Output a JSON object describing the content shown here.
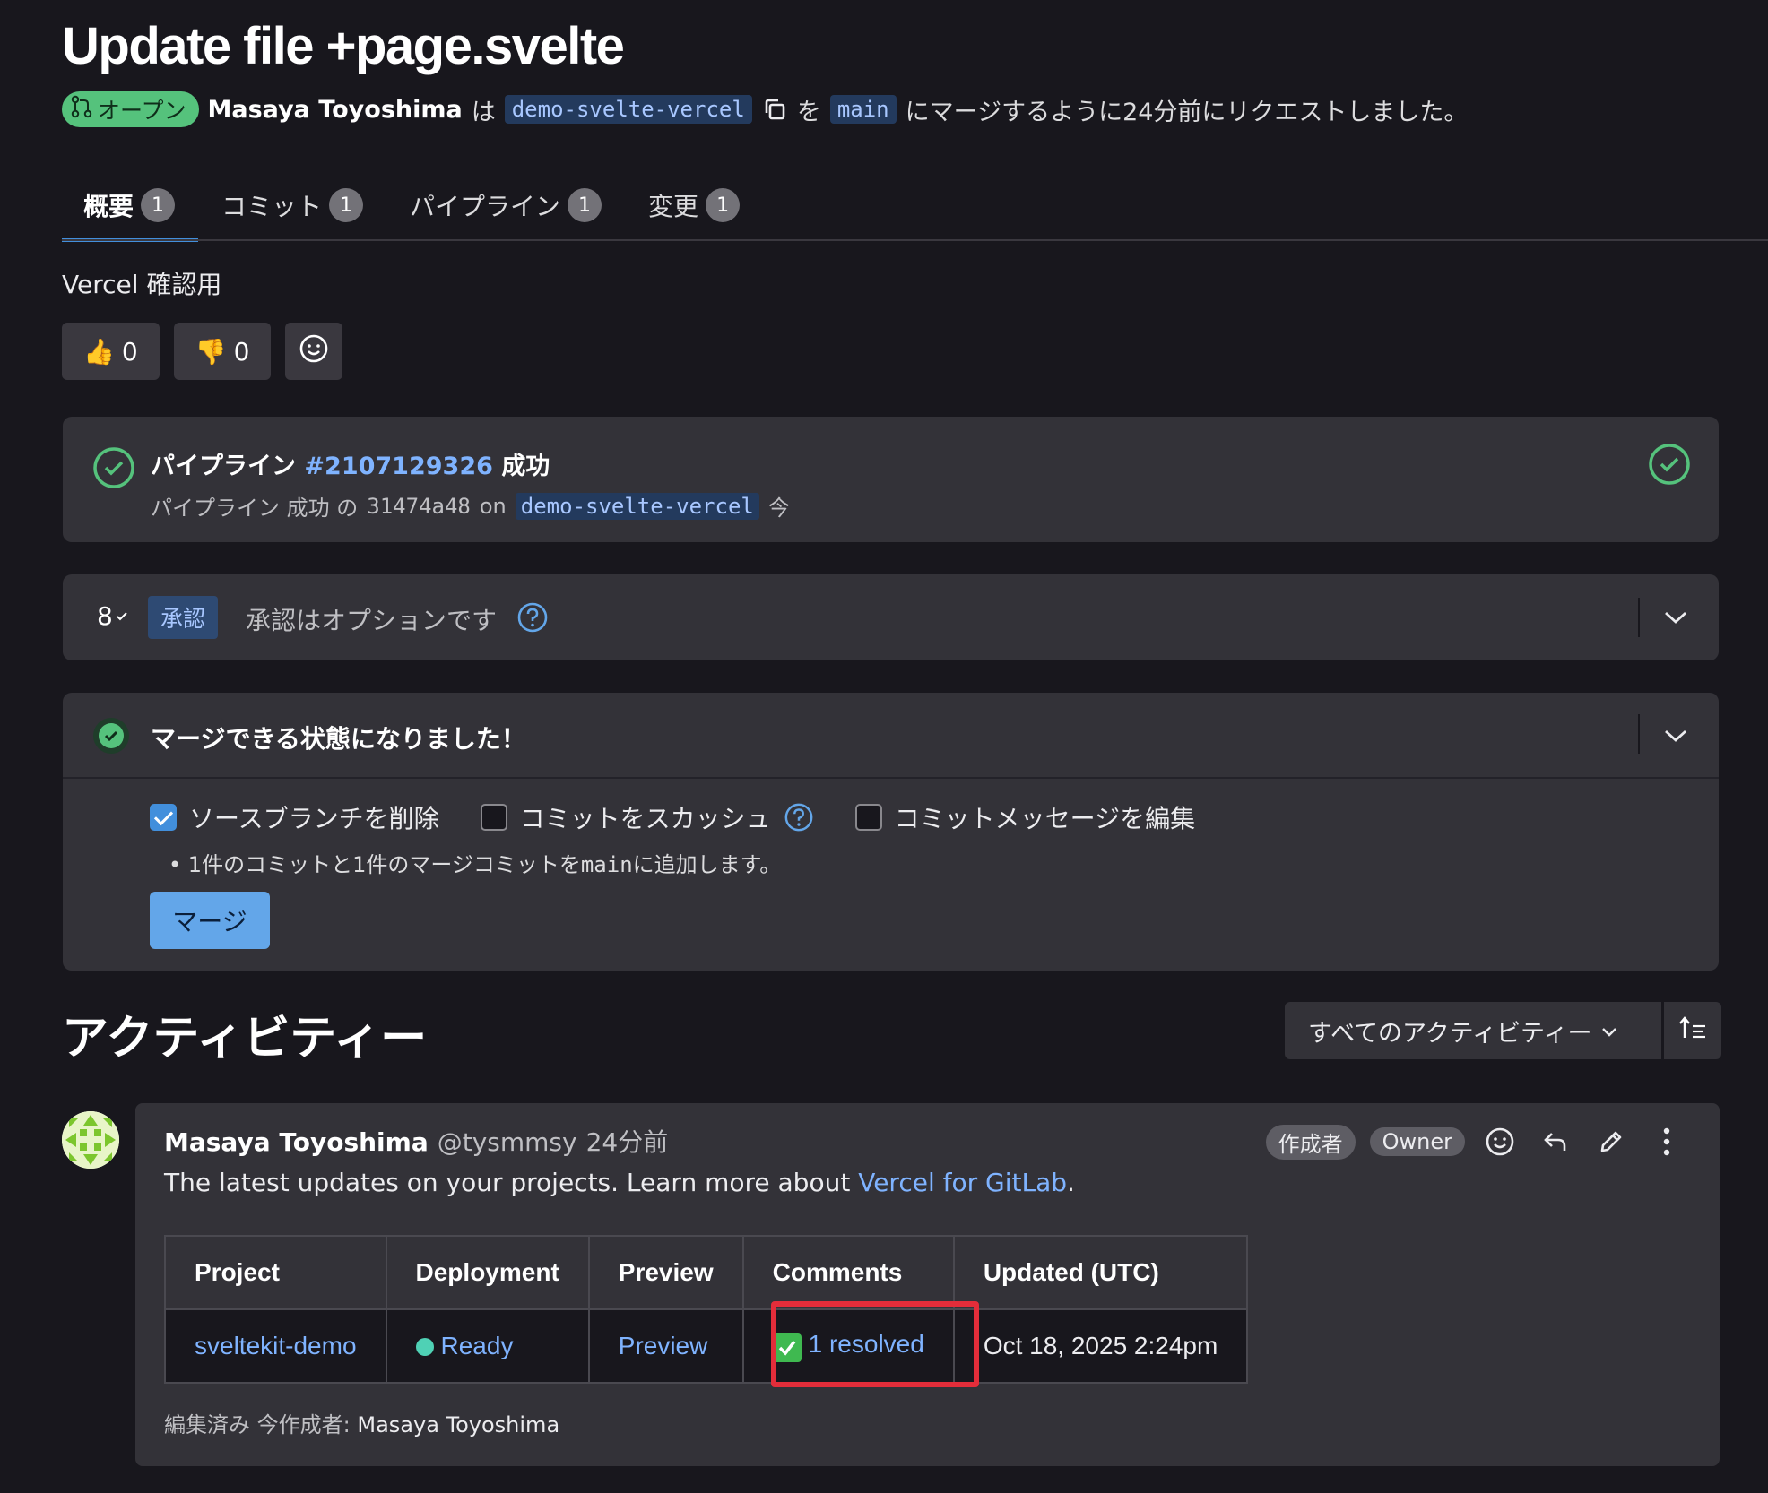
{
  "title": "Update file +page.svelte",
  "meta": {
    "status": "オープン",
    "author": "Masaya Toyoshima",
    "wa": "は",
    "source_branch": "demo-svelte-vercel",
    "wo": "を",
    "target_branch": "main",
    "suffix": "にマージするように24分前にリクエストしました。"
  },
  "tabs": [
    {
      "label": "概要",
      "count": "1"
    },
    {
      "label": "コミット",
      "count": "1"
    },
    {
      "label": "パイプライン",
      "count": "1"
    },
    {
      "label": "変更",
      "count": "1"
    }
  ],
  "description": "Vercel 確認用",
  "reactions": {
    "thumbs_up": "0",
    "thumbs_down": "0"
  },
  "pipeline": {
    "title_prefix": "パイプライン",
    "id": "#2107129326",
    "status": "成功",
    "sub_prefix": "パイプライン 成功 の",
    "commit": "31474a48",
    "on": "on",
    "branch": "demo-svelte-vercel",
    "time": "今"
  },
  "approval": {
    "icon_label": "8",
    "badge": "承認",
    "text": "承認はオプションです"
  },
  "merge": {
    "title": "マージできる状態になりました！",
    "option_delete_branch": "ソースブランチを削除",
    "option_squash": "コミットをスカッシュ",
    "option_edit_message": "コミットメッセージを編集",
    "bullet_pre": "1件のコミットと1件のマージコミットを",
    "bullet_branch": "main",
    "bullet_post": "に追加します。",
    "button": "マージ"
  },
  "activity": {
    "title": "アクティビティー",
    "filter": "すべてのアクティビティー"
  },
  "comment": {
    "author": "Masaya Toyoshima",
    "handle": "@tysmmsy",
    "time": "24分前",
    "tag_author": "作成者",
    "tag_owner": "Owner",
    "body_prefix": "The latest updates on your projects. Learn more about",
    "body_link": "Vercel for GitLab",
    "body_suffix": ".",
    "table": {
      "headers": [
        "Project",
        "Deployment",
        "Preview",
        "Comments",
        "Updated (UTC)"
      ],
      "row": {
        "project": "sveltekit-demo",
        "deployment": "Ready",
        "preview": "Preview",
        "comments": "1 resolved",
        "updated": "Oct 18, 2025 2:24pm"
      }
    },
    "footer_prefix": "編集済み 今作成者:",
    "footer_author": "Masaya Toyoshima"
  },
  "colors": {
    "background": "#18171d",
    "panel": "#333238",
    "accent": "#428fdc",
    "success": "#55c27c",
    "link": "#7fb3ff",
    "highlight": "#e32d3a"
  }
}
